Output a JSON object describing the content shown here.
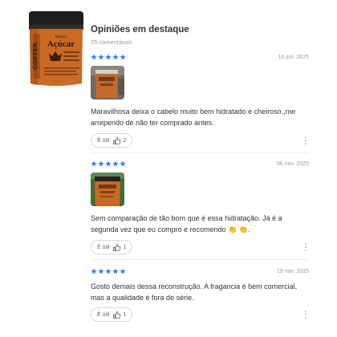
{
  "header": {
    "title": "Opiniões em destaque",
    "subtitle": "25 comentários"
  },
  "product": {
    "brand": "COIFFER",
    "name_top": "Mágico",
    "name": "Açúcar",
    "jar_color": "#c96a25"
  },
  "colors": {
    "star": "#3483fa",
    "divider": "#eeeeee"
  },
  "reviews": [
    {
      "rating": 5,
      "date": "16 jun. 2025",
      "has_photo": true,
      "text": "Maravilhosa deixa o cabelo muito bem hidratado e cheiroso,,me arrependo de não ter comprado antes.",
      "util_label": "É útil",
      "util_count": "2"
    },
    {
      "rating": 5,
      "date": "06 nov. 2025",
      "has_photo": true,
      "text": "Sem comparação de tão bom que é essa hidratação. Já é a segunda vez que eu compro e recomendo 👏 👏.",
      "util_label": "É útil",
      "util_count": "1"
    },
    {
      "rating": 5,
      "date": "19 nov. 2025",
      "has_photo": false,
      "text": "Gosto demais dessa reconstrução. A fragancia é bem comercial, mas a qualidade é fora de série.",
      "util_label": "É útil",
      "util_count": "1"
    }
  ]
}
